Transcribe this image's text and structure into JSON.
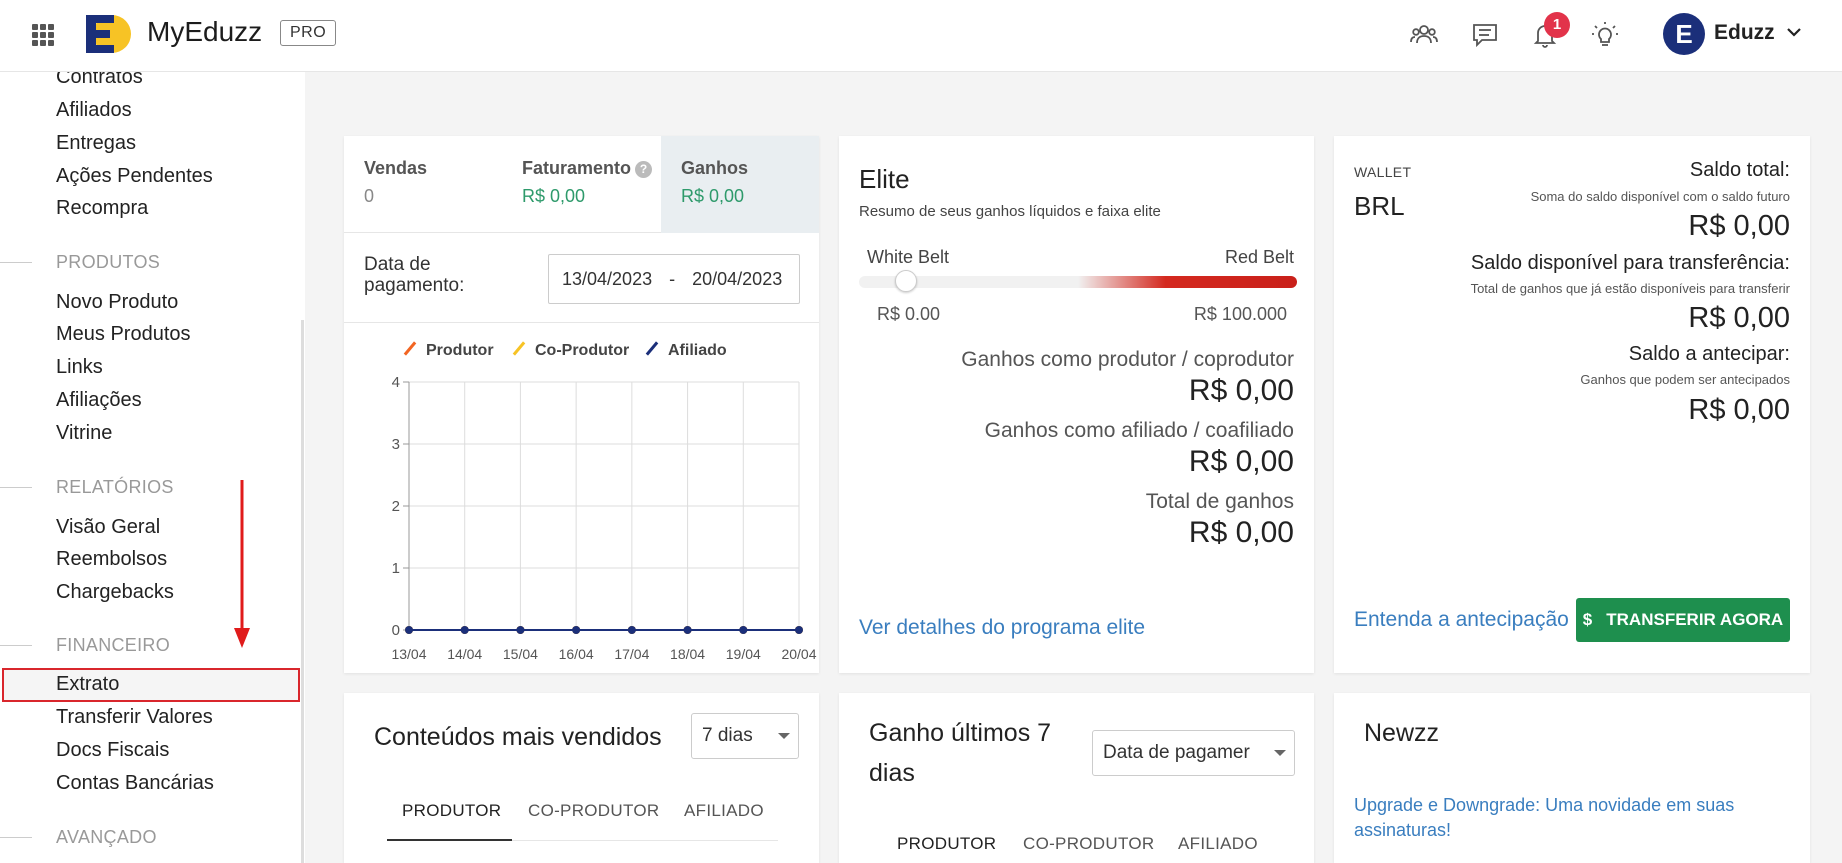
{
  "header": {
    "app_name": "MyEduzz",
    "badge": "PRO",
    "notification_count": "1",
    "user_initial": "E",
    "user_name": "Eduzz",
    "icons": [
      "apps-grid-icon",
      "users-icon",
      "chat-icon",
      "bell-icon",
      "lightbulb-icon",
      "chevron-down-icon"
    ]
  },
  "sidebar": {
    "top_items": [
      "Contratos",
      "Afiliados",
      "Entregas",
      "Ações Pendentes",
      "Recompra"
    ],
    "sections": [
      {
        "title": "PRODUTOS",
        "items": [
          "Novo Produto",
          "Meus Produtos",
          "Links",
          "Afiliações",
          "Vitrine"
        ]
      },
      {
        "title": "RELATÓRIOS",
        "items": [
          "Visão Geral",
          "Reembolsos",
          "Chargebacks"
        ]
      },
      {
        "title": "FINANCEIRO",
        "items": [
          "Extrato",
          "Transferir Valores",
          "Docs Fiscais",
          "Contas Bancárias"
        ]
      },
      {
        "title": "AVANÇADO",
        "items": []
      }
    ],
    "highlighted_item": "Extrato"
  },
  "sales_card": {
    "tabs": [
      {
        "label": "Vendas",
        "value": "0"
      },
      {
        "label": "Faturamento",
        "value": "R$ 0,00"
      },
      {
        "label": "Ganhos",
        "value": "R$ 0,00"
      }
    ],
    "active_tab": "Ganhos",
    "date_label": "Data de pagamento:",
    "date_start": "13/04/2023",
    "date_separator": "-",
    "date_end": "20/04/2023"
  },
  "chart_data": {
    "type": "line",
    "title": "",
    "xlabel": "",
    "ylabel": "",
    "x": [
      "13/04",
      "14/04",
      "15/04",
      "16/04",
      "17/04",
      "18/04",
      "19/04",
      "20/04"
    ],
    "ylim": [
      0,
      4
    ],
    "yticks": [
      "0",
      "1",
      "2",
      "3",
      "4"
    ],
    "grid": true,
    "legend_position": "top",
    "series": [
      {
        "name": "Produtor",
        "color": "#f26522",
        "values": [
          0,
          0,
          0,
          0,
          0,
          0,
          0,
          0
        ]
      },
      {
        "name": "Co-Produtor",
        "color": "#f7c325",
        "values": [
          0,
          0,
          0,
          0,
          0,
          0,
          0,
          0
        ]
      },
      {
        "name": "Afiliado",
        "color": "#1b2f7a",
        "values": [
          0,
          0,
          0,
          0,
          0,
          0,
          0,
          0
        ]
      }
    ]
  },
  "elite_card": {
    "title": "Elite",
    "subtitle": "Resumo de seus ganhos líquidos e faixa elite",
    "belt_left": "White Belt",
    "belt_right": "Red Belt",
    "range_min": "R$ 0.00",
    "range_max": "R$ 100.000",
    "progress_fraction": 0,
    "rows": [
      {
        "label": "Ganhos como produtor / coprodutor",
        "value": "R$ 0,00"
      },
      {
        "label": "Ganhos como afiliado / coafiliado",
        "value": "R$ 0,00"
      },
      {
        "label": "Total de ganhos",
        "value": "R$ 0,00"
      }
    ],
    "link": "Ver detalhes do programa elite"
  },
  "wallet_card": {
    "label": "WALLET",
    "currency": "BRL",
    "rows": [
      {
        "title": "Saldo total:",
        "sub": "Soma do saldo disponível com o saldo futuro",
        "value": "R$ 0,00"
      },
      {
        "title": "Saldo disponível para transferência:",
        "sub": "Total de ganhos que já estão disponíveis para transferir",
        "value": "R$ 0,00"
      },
      {
        "title": "Saldo a antecipar:",
        "sub": "Ganhos que podem ser antecipados",
        "value": "R$ 0,00"
      }
    ],
    "link": "Entenda a antecipação",
    "button_icon": "$",
    "button_label": "TRANSFERIR AGORA"
  },
  "top_content_card": {
    "title": "Conteúdos mais vendidos",
    "period": "7 dias",
    "tabs": [
      "PRODUTOR",
      "CO-PRODUTOR",
      "AFILIADO"
    ]
  },
  "earnings_card": {
    "title_line1": "Ganho últimos 7",
    "title_line2": "dias",
    "filter": "Data de pagamer",
    "tabs": [
      "PRODUTOR",
      "CO-PRODUTOR",
      "AFILIADO"
    ]
  },
  "news_card": {
    "title": "Newzz",
    "link": "Upgrade e Downgrade: Uma novidade em suas assinaturas!"
  },
  "colors": {
    "brand_blue": "#1b2f7a",
    "brand_yellow": "#f7c325",
    "green": "#2e9a6b",
    "button_green": "#1e8f4e",
    "link_blue": "#3a7ebf",
    "highlight_red": "#d9262c"
  }
}
